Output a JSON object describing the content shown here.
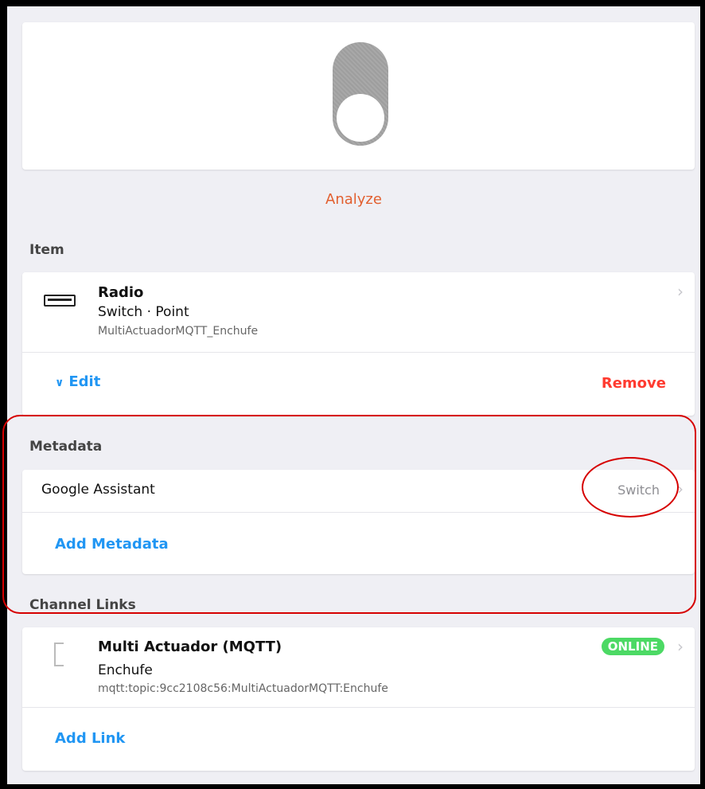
{
  "analyze_label": "Analyze",
  "item_section": {
    "title": "Item",
    "item": {
      "label": "Radio",
      "type_line": "Switch · Point",
      "name": "MultiActuadorMQTT_Enchufe",
      "icon": "radio-icon"
    },
    "edit_label": "Edit",
    "remove_label": "Remove"
  },
  "metadata_section": {
    "title": "Metadata",
    "entries": [
      {
        "label": "Google Assistant",
        "value": "Switch"
      }
    ],
    "add_label": "Add Metadata"
  },
  "channel_links_section": {
    "title": "Channel Links",
    "links": [
      {
        "thing": "Multi Actuador (MQTT)",
        "channel": "Enchufe",
        "uid": "mqtt:topic:9cc2108c56:MultiActuadorMQTT:Enchufe",
        "status": "ONLINE"
      }
    ],
    "add_label": "Add Link"
  },
  "colors": {
    "accent_orange": "#e25f2f",
    "link_blue": "#2196f3",
    "remove_red": "#ff3b30",
    "online_green": "#4cd964",
    "annotation_red": "#d60000"
  }
}
